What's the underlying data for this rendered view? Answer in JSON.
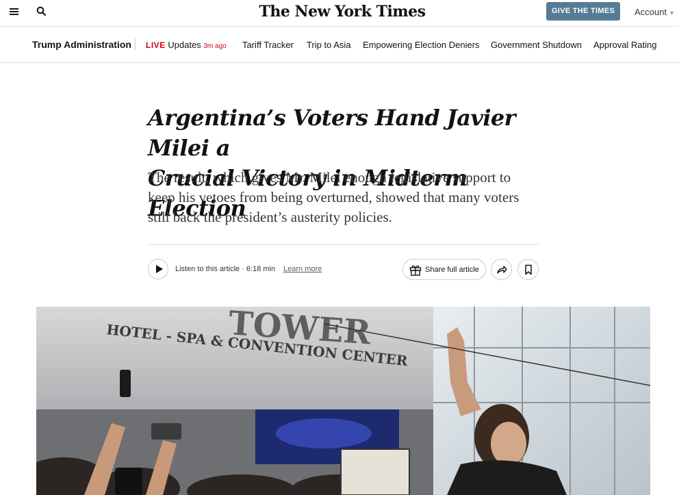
{
  "masthead": {
    "logo": "The New York Times",
    "give_button": "GIVE THE TIMES",
    "account": "Account",
    "icons": {
      "menu": "hamburger-menu-icon",
      "search": "search-icon",
      "account_chevron": "chevron-down-icon"
    }
  },
  "subnav": {
    "section": "Trump Administration",
    "live_label": "LIVE",
    "live_text": "Updates",
    "live_time": "3m ago",
    "links": [
      "Tariff Tracker",
      "Trip to Asia",
      "Empowering Election Deniers",
      "Government Shutdown",
      "Approval Rating"
    ],
    "live_color": "#d0021b"
  },
  "article": {
    "headline_line1": "Argentina’s Voters Hand Javier Milei a",
    "headline_line2": "Crucial Victory in Midterm Election",
    "summary": "The result, which gives Mr. Milei enough legislative support to keep his vetoes from being overturned, showed that many voters still back the president’s austerity policies."
  },
  "toolbar": {
    "listen_label": "Listen to this article · 6:18 min",
    "learn_more": "Learn more",
    "share_label": "Share full article",
    "icons": {
      "play": "play-icon",
      "gift": "gift-icon",
      "share": "share-arrow-icon",
      "bookmark": "bookmark-icon"
    }
  },
  "photo": {
    "sign_line1": "HOTEL - SPA & CONVENTION CENTER",
    "sign_tower": "TOWER"
  },
  "colors": {
    "give_button": "#567b95",
    "live": "#d0021b"
  }
}
